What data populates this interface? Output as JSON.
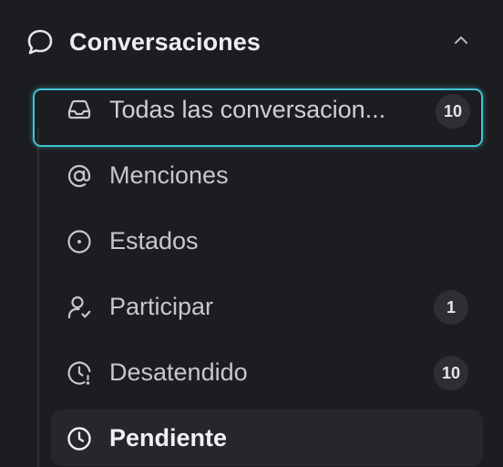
{
  "sidebar": {
    "section": {
      "title": "Conversaciones",
      "icon": "chat-bubble-icon",
      "collapse_icon": "chevron-up-icon"
    },
    "items": [
      {
        "label": "Todas las conversacion...",
        "icon": "inbox-icon",
        "badge": "10",
        "state": "focused"
      },
      {
        "label": "Menciones",
        "icon": "at-sign-icon",
        "badge": ""
      },
      {
        "label": "Estados",
        "icon": "status-circle-icon",
        "badge": ""
      },
      {
        "label": "Participar",
        "icon": "user-check-icon",
        "badge": "1"
      },
      {
        "label": "Desatendido",
        "icon": "clock-alert-icon",
        "badge": "10"
      },
      {
        "label": "Pendiente",
        "icon": "clock-icon",
        "badge": "",
        "state": "active"
      }
    ]
  },
  "colors": {
    "background": "#1c1d20",
    "focus_ring": "#3fc3d3",
    "active_bg": "#26272b",
    "badge_bg": "#2e2f34"
  }
}
